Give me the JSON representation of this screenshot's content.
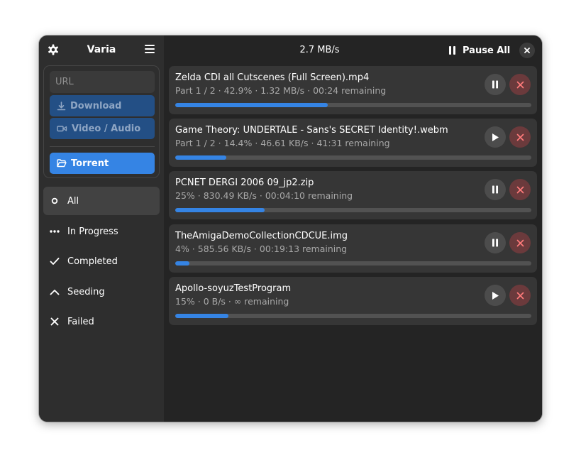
{
  "app": {
    "title": "Varia"
  },
  "sidebar": {
    "url_placeholder": "URL",
    "download_label": "Download",
    "video_label": "Video / Audio",
    "torrent_label": "Torrent",
    "filters": [
      {
        "label": "All",
        "icon": "circle-icon",
        "active": true
      },
      {
        "label": "In Progress",
        "icon": "ellipsis-icon",
        "active": false
      },
      {
        "label": "Completed",
        "icon": "checkmark-icon",
        "active": false
      },
      {
        "label": "Seeding",
        "icon": "chevron-up-icon",
        "active": false
      },
      {
        "label": "Failed",
        "icon": "x-icon",
        "active": false
      }
    ]
  },
  "header": {
    "speed": "2.7 MB/s",
    "pause_all_label": "Pause All"
  },
  "downloads": [
    {
      "name": "Zelda CDI all Cutscenes (Full Screen).mp4",
      "detail": "Part 1 / 2  ·  42.9%  ·  1.32 MB/s  ·  00:24 remaining",
      "progress": 0.429,
      "state": "running"
    },
    {
      "name": "Game Theory: UNDERTALE - Sans's SECRET Identity!.webm",
      "detail": "Part 1 / 2  ·  14.4%  ·  46.61 KB/s  ·  41:31 remaining",
      "progress": 0.144,
      "state": "paused"
    },
    {
      "name": "PCNET DERGI 2006 09_jp2.zip",
      "detail": "25%  ·  830.49  KB/s  ·  00:04:10 remaining",
      "progress": 0.25,
      "state": "running"
    },
    {
      "name": "TheAmigaDemoCollectionCDCUE.img",
      "detail": "4%  ·  585.56  KB/s  ·  00:19:13 remaining",
      "progress": 0.04,
      "state": "running"
    },
    {
      "name": "Apollo-soyuzTestProgram",
      "detail": "15%  ·  0  B/s  ·  ∞ remaining",
      "progress": 0.15,
      "state": "paused"
    }
  ],
  "colors": {
    "accent": "#3584e4",
    "cancel": "#ff7b7b",
    "window_bg": "#242424",
    "sidebar_bg": "#2e2e2e",
    "card_bg": "#363636"
  }
}
